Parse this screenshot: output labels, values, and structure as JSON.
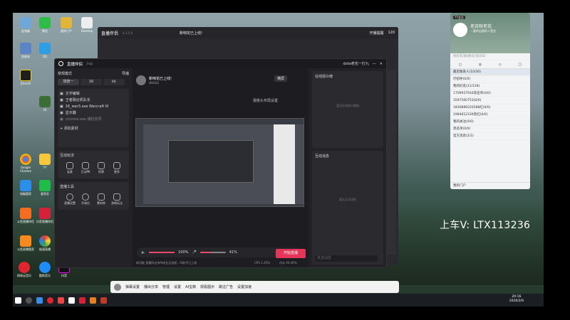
{
  "desktop_icons": [
    {
      "label": "此电脑"
    },
    {
      "label": "微信"
    },
    {
      "label": "我的门户"
    },
    {
      "label": "Desktop"
    },
    {
      "label": "回收站"
    },
    {
      "label": "QQ"
    },
    {
      "label": "DirectX"
    },
    {
      "label": "16"
    },
    {
      "label": "Google Chrome"
    },
    {
      "label": "YY"
    },
    {
      "label": "电脑管家"
    },
    {
      "label": "爱奇艺"
    },
    {
      "label": "斗鱼直播伴侣"
    },
    {
      "label": "抖音直播伴侣"
    },
    {
      "label": "斗鱼直播管家"
    },
    {
      "label": "极速直播"
    },
    {
      "label": "网易云音乐"
    },
    {
      "label": "酷狗音乐"
    },
    {
      "label": "抖音"
    }
  ],
  "bg_window": {
    "title": "直播伴侣",
    "version": "4.3.5.4",
    "room_title": "新响花已上线!",
    "tabs": [
      "精简",
      "粉丝"
    ],
    "right_label": "开播提醒",
    "count": "120"
  },
  "main_window": {
    "title": "直播伴侣",
    "version": "34省",
    "user_label": "dota老花一打九",
    "mode": "常规模式",
    "import_label": "导播",
    "scene_tabs": [
      "场景一",
      "16",
      "kk"
    ],
    "sources": [
      {
        "name": "文字编辑"
      },
      {
        "name": "王者融合机队长"
      },
      {
        "name": "16_war3.exe Warcraft III"
      },
      {
        "name": "显示器"
      },
      {
        "name": "chrome.exe 播控向导"
      }
    ],
    "add_source": "+ 添加素材",
    "interact_title": "互动玩法",
    "interact_items": [
      "连麦",
      "互动PK",
      "投票",
      "更多"
    ],
    "tools_title": "直播工具",
    "tool_items": [
      "直播设置",
      "开始位",
      "素材库",
      "游戏玩法"
    ],
    "room_title": "新响花已上线!",
    "room_sub": "dota1",
    "landscape": "横屏",
    "camera_layout": "摄像头布局设置",
    "volume_left": "100%",
    "volume_right": "41%",
    "go_live": "开始直播",
    "status_text": "新功能 直播间支持AI成长全流程，AI助手已上线",
    "cpu": "CPU 1.45%",
    "mem": "内存 49.46%",
    "online_title": "在线观众榜",
    "online_empty": "暂无在线观众数据",
    "msg_title": "互动消息",
    "msg_empty": "暂无互动消息",
    "msg_input": "发送消息"
  },
  "qq_window": {
    "badge": "YY会员",
    "name": "老花呀老花",
    "sig": "一要你自我的人签名",
    "search": "找好友/群/群号/房间ID",
    "rows": [
      "最近联系人(10/30)",
      "打招呼(0/0)",
      "我的好友(21/128)",
      "1709937916黑名单(0/0)",
      "3597560753(0/0)",
      "1830889220588红(0/0)",
      "1984612339黑红(0/0)",
      "我的关注(0/0)",
      "黑名单(0/0)",
      "官方消息(2/2)"
    ],
    "footer": "我的门户"
  },
  "watermark": "上车V:  LTX113236",
  "bottom_bar": {
    "items": [
      "弹幕设置",
      "播出分享",
      "管理",
      "设置",
      "AI宝典",
      "观看图示",
      "跳过广告",
      "设置加速"
    ]
  },
  "clock": {
    "time": "20:16",
    "date": "2026/2/6"
  }
}
